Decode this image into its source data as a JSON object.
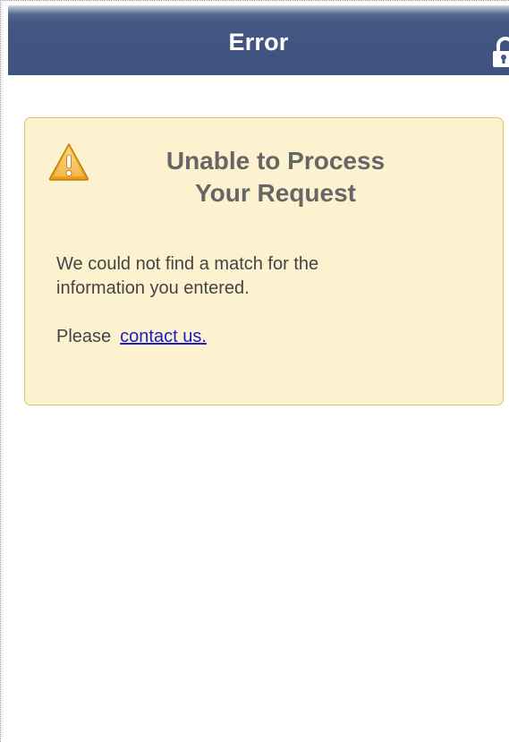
{
  "header": {
    "title": "Error",
    "lock_icon": "unlock-icon"
  },
  "message": {
    "icon": "warning-icon",
    "title_line1": "Unable to Process",
    "title_line2": "Your Request",
    "body_line1": "We could not find a match for the",
    "body_line2": "information you entered.",
    "contact_prefix": "Please",
    "contact_link": "contact us."
  },
  "colors": {
    "header_bg": "#425782",
    "message_bg": "#fdf2cf",
    "message_border": "#ecc25a",
    "link": "#1b1bcc",
    "warning": "#f2a81b"
  }
}
